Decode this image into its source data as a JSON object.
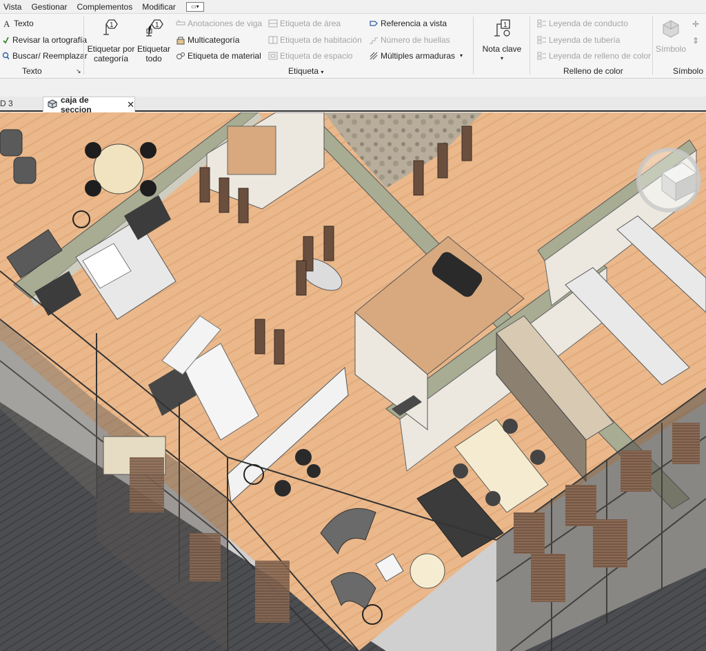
{
  "menu": {
    "items": [
      "Vista",
      "Gestionar",
      "Complementos",
      "Modificar"
    ]
  },
  "ribbon": {
    "texto_panel": {
      "label": "Texto",
      "items": [
        "Texto",
        "Revisar la  ortografía",
        "Buscar/ Reemplazar"
      ]
    },
    "etiqueta_panel": {
      "label": "Etiqueta",
      "btn_categoria": [
        "Etiquetar por",
        "categoría"
      ],
      "btn_todo": [
        "Etiquetar",
        "todo"
      ],
      "col1": [
        "Anotaciones de viga",
        "Multicategoría",
        "Etiqueta de material"
      ],
      "col2": [
        "Etiqueta de área",
        "Etiqueta de habitación",
        "Etiqueta de espacio"
      ],
      "col3": [
        "Referencia a vista",
        "Número  de huellas",
        "Múltiples  armaduras"
      ]
    },
    "nota_clave": "Nota clave",
    "relleno_panel": {
      "label": "Relleno de color",
      "items": [
        "Leyenda de conducto",
        "Leyenda de tubería",
        "Leyenda de relleno de color"
      ]
    },
    "simbolo_panel": {
      "label": "Símbolo",
      "button": "Símbolo"
    }
  },
  "tabs": {
    "previous": "D 3",
    "active": "caja de seccion",
    "close": "✕"
  },
  "viewport": {
    "description_icons": [
      "viewcube-icon"
    ],
    "colors": {
      "floor": "#e9b58a",
      "wall_top": "#a7ac92",
      "wall_face": "#ece8e0",
      "dark_furniture": "#4a4a4a"
    }
  }
}
